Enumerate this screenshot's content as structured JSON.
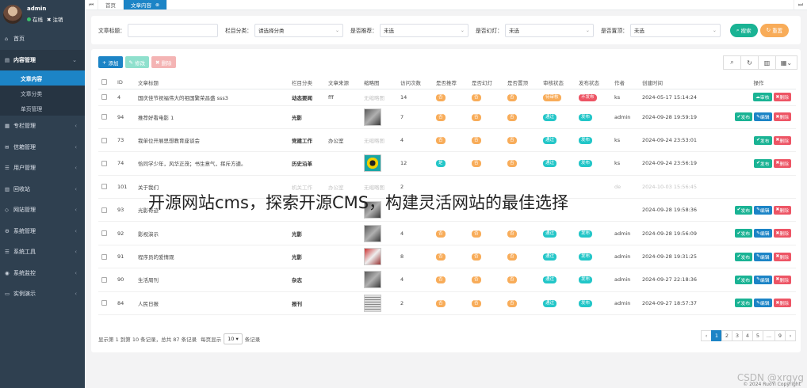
{
  "user": {
    "name": "admin",
    "status": "在线",
    "logout": "注销"
  },
  "sidebar": {
    "items": [
      {
        "label": "首页",
        "icon": "home-icon",
        "glyph": "⌂"
      },
      {
        "label": "内容管理",
        "icon": "content-icon",
        "glyph": "▤",
        "open": true,
        "children": [
          {
            "label": "文章内容",
            "active": true
          },
          {
            "label": "文章分类"
          },
          {
            "label": "单页管理"
          }
        ]
      },
      {
        "label": "专栏管理",
        "icon": "column-icon",
        "glyph": "▦"
      },
      {
        "label": "信箱管理",
        "icon": "mail-icon",
        "glyph": "✉"
      },
      {
        "label": "用户管理",
        "icon": "user-icon",
        "glyph": "☰"
      },
      {
        "label": "回收站",
        "icon": "trash-icon",
        "glyph": "▥"
      },
      {
        "label": "网站管理",
        "icon": "site-icon",
        "glyph": "◇"
      },
      {
        "label": "系统管理",
        "icon": "settings-icon",
        "glyph": "⚙"
      },
      {
        "label": "系统工具",
        "icon": "tools-icon",
        "glyph": "☰"
      },
      {
        "label": "系统监控",
        "icon": "monitor-icon",
        "glyph": "◉"
      },
      {
        "label": "实例演示",
        "icon": "demo-icon",
        "glyph": "▭"
      }
    ]
  },
  "topbar": {
    "prev": "⏮",
    "next": "⏭",
    "tabs": [
      {
        "label": "首页"
      },
      {
        "label": "文章内容",
        "active": true
      }
    ]
  },
  "search": {
    "title_label": "文章标题：",
    "title_value": "",
    "column_label": "栏目分类：",
    "column_value": "请选择分类",
    "recommend_label": "是否推荐：",
    "recommend_value": "未选",
    "slide_label": "是否幻灯：",
    "slide_value": "未选",
    "top_label": "是否置顶：",
    "top_value": "未选",
    "search_btn": "搜索",
    "reset_btn": "重置"
  },
  "toolbar": {
    "add": "添加",
    "edit": "修改",
    "delete": "删除"
  },
  "table": {
    "headers": [
      "",
      "ID",
      "文章标题",
      "栏目分类",
      "文章来源",
      "缩略图",
      "访问次数",
      "是否推荐",
      "是否幻灯",
      "是否置顶",
      "审核状态",
      "发布状态",
      "作者",
      "创建时间",
      "操作"
    ],
    "rows": [
      {
        "id": "4",
        "title": "国庆佳节祝福伟大的祖国繁荣昌盛 sss3",
        "category": "动态要闻",
        "source": "fff",
        "thumb": "无缩略图",
        "views": "14",
        "recommend": "否",
        "slide": "否",
        "top": "否",
        "audit": "待审核",
        "publish": "不发布",
        "author": "ks",
        "created": "2024-05-17 15:14:24",
        "ops": [
          "审核",
          "删除"
        ]
      },
      {
        "id": "94",
        "title": "推荐好看电影 1",
        "category": "光影",
        "source": "",
        "thumb": "img",
        "views": "7",
        "recommend": "否",
        "slide": "否",
        "top": "否",
        "audit": "通过",
        "publish": "发布",
        "author": "admin",
        "created": "2024-09-28 19:59:19",
        "ops": [
          "发布",
          "编辑",
          "删除"
        ]
      },
      {
        "id": "73",
        "title": "我单位开展思想教育座谈会",
        "category": "党建工作",
        "source": "办公室",
        "thumb": "无缩略图",
        "views": "4",
        "recommend": "否",
        "slide": "否",
        "top": "否",
        "audit": "通过",
        "publish": "发布",
        "author": "ks",
        "created": "2024-09-24 23:53:01",
        "ops": [
          "发布",
          "删除"
        ]
      },
      {
        "id": "74",
        "title": "恰同学少年，风华正茂；书生意气，挥斥方遒。",
        "category": "历史沿革",
        "source": "",
        "thumb": "yellow",
        "views": "12",
        "recommend": "是",
        "slide": "否",
        "top": "否",
        "audit": "通过",
        "publish": "发布",
        "author": "ks",
        "created": "2024-09-24 23:56:19",
        "ops": [
          "发布",
          "删除"
        ]
      },
      {
        "id": "101",
        "title": "关于我们",
        "category": "机关工作",
        "source": "办公室",
        "thumb": "无缩略图",
        "views": "2",
        "recommend": "",
        "slide": "",
        "top": "",
        "audit": "",
        "publish": "",
        "author": "de",
        "created": "2024-10-03 15:56:45",
        "ops": []
      },
      {
        "id": "93",
        "title": "光影奇迹",
        "category": "",
        "source": "",
        "thumb": "img",
        "views": "",
        "recommend": "",
        "slide": "",
        "top": "",
        "audit": "",
        "publish": "",
        "author": "",
        "created": "2024-09-28 19:58:36",
        "ops": [
          "发布",
          "编辑",
          "删除"
        ]
      },
      {
        "id": "92",
        "title": "影视演示",
        "category": "光影",
        "source": "",
        "thumb": "img",
        "views": "4",
        "recommend": "否",
        "slide": "否",
        "top": "否",
        "audit": "通过",
        "publish": "发布",
        "author": "admin",
        "created": "2024-09-28 19:56:09",
        "ops": [
          "发布",
          "编辑",
          "删除"
        ]
      },
      {
        "id": "91",
        "title": "程序员的爱情观",
        "category": "光影",
        "source": "",
        "thumb": "red",
        "views": "8",
        "recommend": "否",
        "slide": "否",
        "top": "否",
        "audit": "通过",
        "publish": "发布",
        "author": "admin",
        "created": "2024-09-28 19:31:25",
        "ops": [
          "发布",
          "编辑",
          "删除"
        ]
      },
      {
        "id": "90",
        "title": "生活周刊",
        "category": "杂志",
        "source": "",
        "thumb": "img",
        "views": "4",
        "recommend": "否",
        "slide": "否",
        "top": "否",
        "audit": "通过",
        "publish": "发布",
        "author": "admin",
        "created": "2024-09-27 22:18:36",
        "ops": [
          "发布",
          "编辑",
          "删除"
        ]
      },
      {
        "id": "84",
        "title": "人民日报",
        "category": "报刊",
        "source": "",
        "thumb": "news",
        "views": "2",
        "recommend": "否",
        "slide": "否",
        "top": "否",
        "audit": "通过",
        "publish": "发布",
        "author": "admin",
        "created": "2024-09-27 18:57:37",
        "ops": [
          "发布",
          "编辑",
          "删除"
        ]
      }
    ]
  },
  "footer": {
    "summary": "显示第 1 到第 10 条记录，总共 87 条记录",
    "per_page_pre": "每页显示",
    "page_size": "10",
    "per_page_post": "条记录",
    "pages": [
      "‹",
      "1",
      "2",
      "3",
      "4",
      "5",
      "...",
      "9",
      "›"
    ],
    "active_page": "1"
  },
  "copyright": "© 2024 RuoYi Copyright",
  "overlay_title": "开源网站cms，探索开源CMS，构建灵活网站的最佳选择",
  "watermark": "CSDN @xrgyg",
  "colors": {
    "sidebar": "#2f4050",
    "primary": "#1c84c6",
    "success": "#1ab394",
    "warning": "#f8ac59",
    "danger": "#ed5565",
    "info": "#23c6c8"
  }
}
